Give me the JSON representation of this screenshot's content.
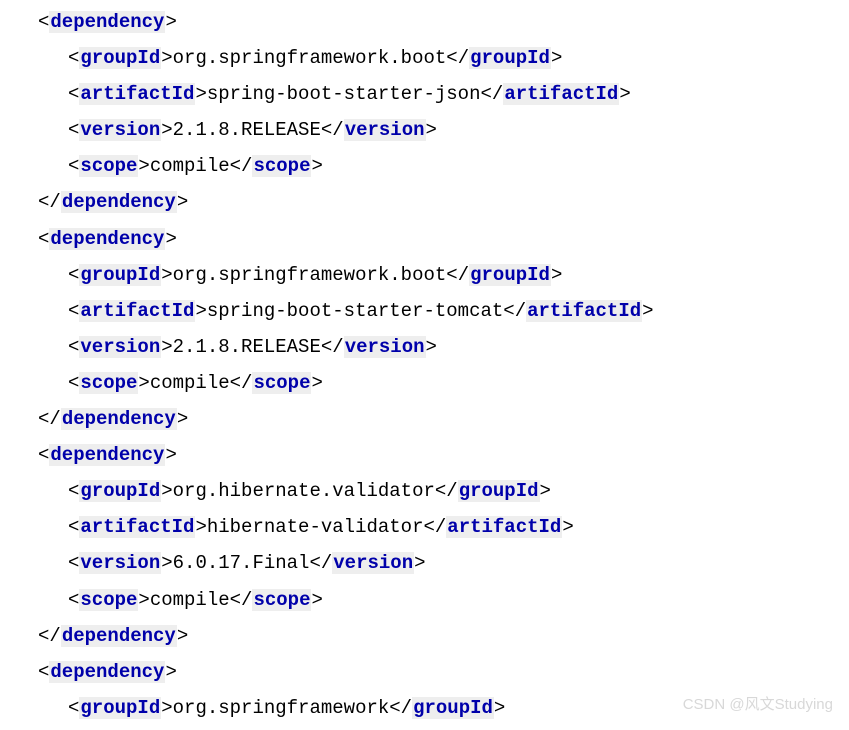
{
  "dependencies": [
    {
      "groupId": "org.springframework.boot",
      "artifactId": "spring-boot-starter-json",
      "version": "2.1.8.RELEASE",
      "scope": "compile",
      "closed": true
    },
    {
      "groupId": "org.springframework.boot",
      "artifactId": "spring-boot-starter-tomcat",
      "version": "2.1.8.RELEASE",
      "scope": "compile",
      "closed": true
    },
    {
      "groupId": "org.hibernate.validator",
      "artifactId": "hibernate-validator",
      "version": "6.0.17.Final",
      "scope": "compile",
      "closed": true
    },
    {
      "groupId": "org.springframework",
      "closed": false
    }
  ],
  "tags": {
    "dependency": "dependency",
    "groupId": "groupId",
    "artifactId": "artifactId",
    "version": "version",
    "scope": "scope"
  },
  "watermark": "CSDN @风文Studying"
}
